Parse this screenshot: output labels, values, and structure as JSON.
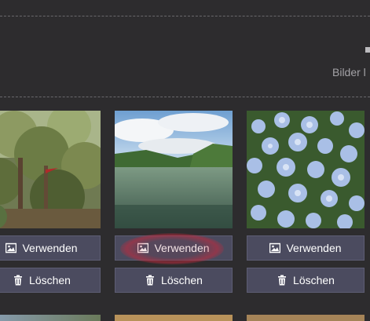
{
  "header": {
    "label": "Bilder l"
  },
  "gallery": {
    "items": [
      {
        "use_label": "Verwenden",
        "delete_label": "Löschen",
        "image": "tree-with-branches"
      },
      {
        "use_label": "Verwenden",
        "delete_label": "Löschen",
        "image": "lake-landscape"
      },
      {
        "use_label": "Verwenden",
        "delete_label": "Löschen",
        "image": "blue-flowering-bush"
      }
    ]
  },
  "icons": {
    "use": "image-icon",
    "delete": "trash-icon"
  },
  "colors": {
    "background": "#2d2c2e",
    "button": "#4b4b5f",
    "button_text": "#ffffff",
    "highlight": "#c8283c"
  }
}
